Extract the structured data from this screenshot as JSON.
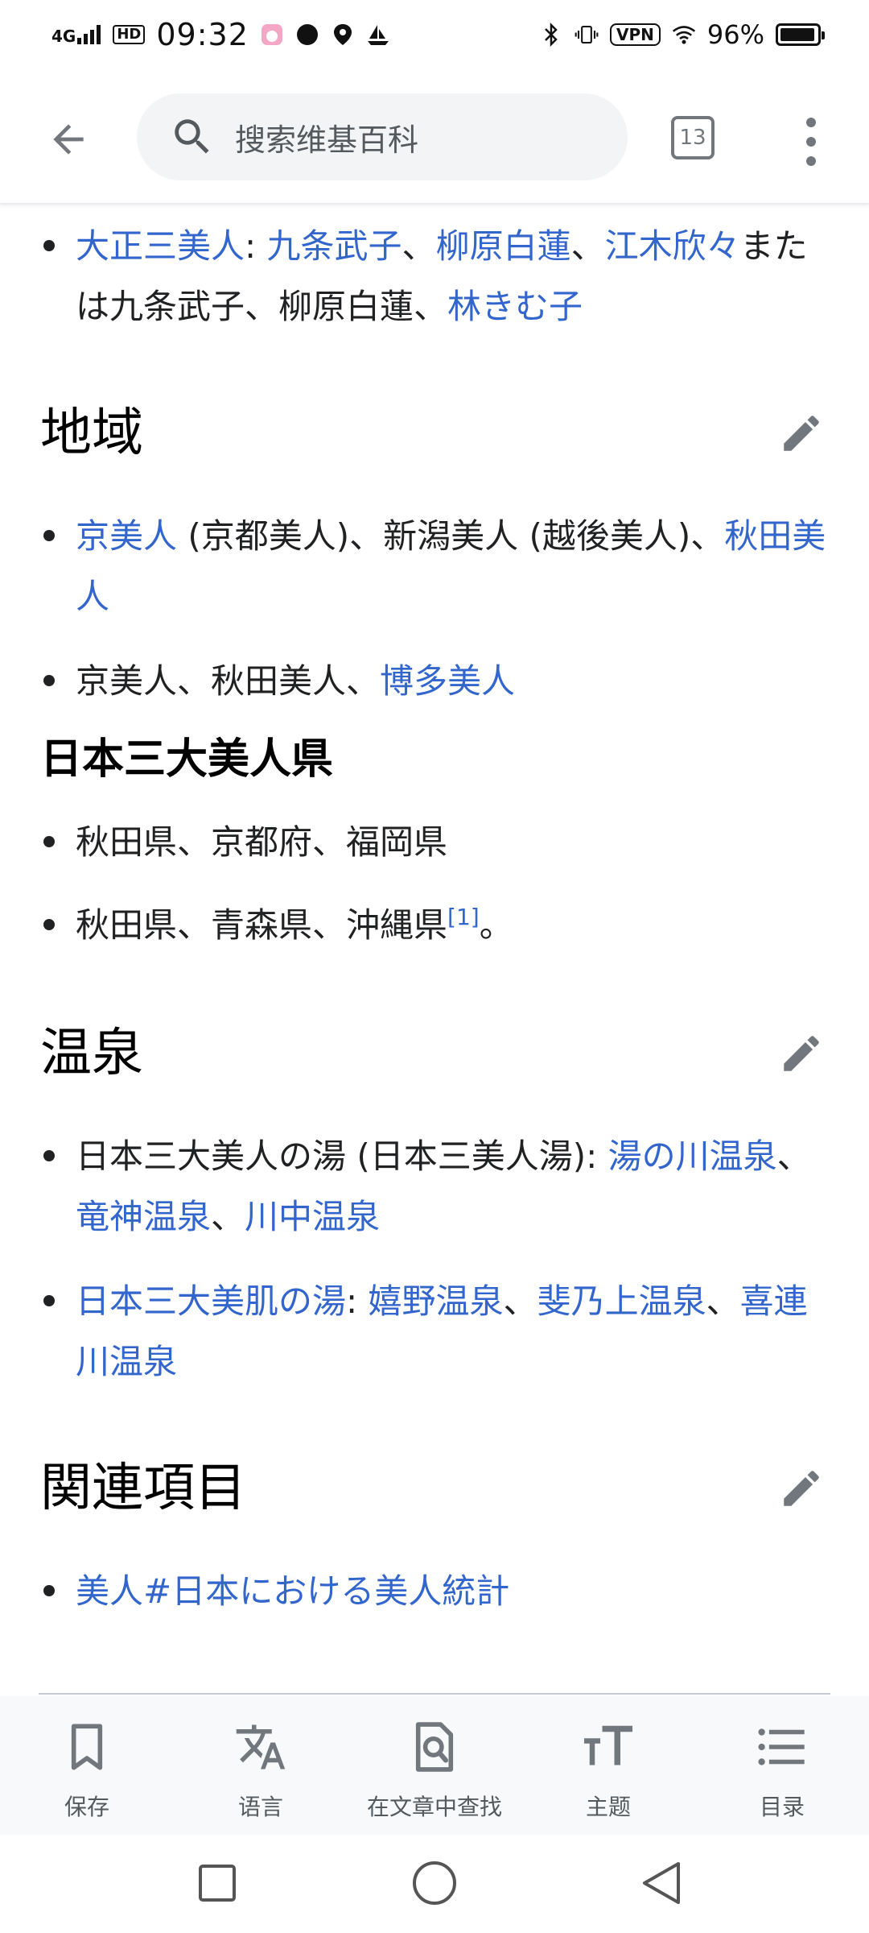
{
  "status_bar": {
    "network": "4G",
    "hd": "HD",
    "time": "09:32",
    "vpn": "VPN",
    "battery_percent": "96%",
    "battery_level": 0.96
  },
  "app_bar": {
    "search_placeholder": "搜索维基百科",
    "tab_count": "13"
  },
  "content": {
    "item_taisho": {
      "link1": "大正三美人",
      "sep1": ": ",
      "link2": "九条武子",
      "sep2": "、",
      "link3": "柳原白蓮",
      "sep3": "、",
      "link4": "江木欣々",
      "text_line": "または九条武子、柳原白蓮、",
      "link5": "林きむ子"
    },
    "section_region": {
      "title": "地域",
      "item1_link1": "京美人",
      "item1_text": " (京都美人)、新潟美人 (越後美人)、",
      "item1_link2a": "秋",
      "item1_link2b": "田美人",
      "item2_text": "京美人、秋田美人、",
      "item2_link": "博多美人",
      "subheading": "日本三大美人県",
      "item3_text": "秋田県、京都府、福岡県",
      "item4_text": "秋田県、青森県、沖縄県",
      "item4_ref": "[1]",
      "item4_end": "。"
    },
    "section_onsen": {
      "title": "温泉",
      "item1_text": "日本三大美人の湯 (日本三美人湯): ",
      "item1_link1a": "湯の川温",
      "item1_link1b": "泉",
      "item1_sep1": "、",
      "item1_link2": "竜神温泉",
      "item1_sep2": "、",
      "item1_link3": "川中温泉",
      "item2_link1": "日本三大美肌の湯",
      "item2_sep1": ": ",
      "item2_link2": "嬉野温泉",
      "item2_sep2": "、",
      "item2_link3": "斐乃上温泉",
      "item2_sep3": "、",
      "item2_link4a": "喜",
      "item2_link4b": "連川温泉"
    },
    "section_related": {
      "title": "関連項目",
      "item1_link": "美人#日本における美人統計"
    }
  },
  "bottom_toolbar": {
    "items": [
      {
        "label": "保存",
        "icon": "bookmark-icon"
      },
      {
        "label": "语言",
        "icon": "translate-icon"
      },
      {
        "label": "在文章中查找",
        "icon": "find-in-page-icon"
      },
      {
        "label": "主题",
        "icon": "text-size-icon"
      },
      {
        "label": "目录",
        "icon": "list-icon"
      }
    ]
  },
  "colors": {
    "link": "#3366cc",
    "text": "#202122",
    "icon_gray": "#72777d"
  }
}
